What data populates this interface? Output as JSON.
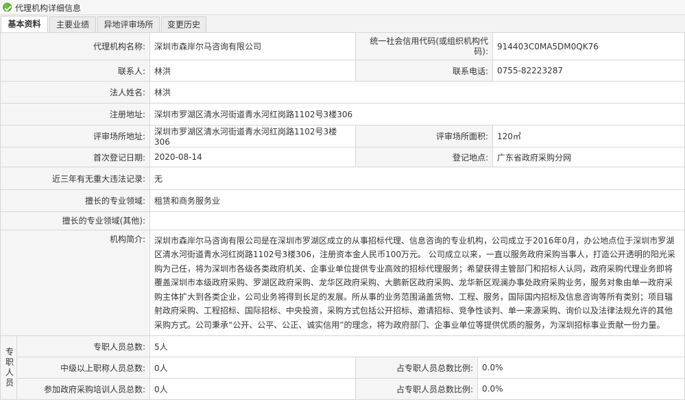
{
  "window": {
    "title": "代理机构详细信息",
    "icon": "info-check-icon"
  },
  "tabs": [
    {
      "label": "基本资料",
      "active": true
    },
    {
      "label": "主要业绩",
      "active": false
    },
    {
      "label": "异地评审场所",
      "active": false
    },
    {
      "label": "变更历史",
      "active": false
    }
  ],
  "info": {
    "agency_name": {
      "label": "代理机构名称:",
      "value": "深圳市森岸尔马咨询有限公司"
    },
    "credit_code": {
      "label": "统一社会信用代码(或组织机构代码):",
      "value": "914403C0MA5DM0QK76"
    },
    "contact": {
      "label": "联系人:",
      "value": "林洪"
    },
    "phone": {
      "label": "联系电话:",
      "value": "0755-82223287"
    },
    "legal_rep": {
      "label": "法人姓名:",
      "value": "林洪"
    },
    "reg_address": {
      "label": "注册地址:",
      "value": "深圳市罗湖区清水河街道青水河红岗路1102号3楼306"
    },
    "review_address": {
      "label": "评审场所地址:",
      "value": "深圳市罗湖区清水河街道青水河红岗路1102号3楼306"
    },
    "review_area": {
      "label": "评审场所面积:",
      "value": "120㎡"
    },
    "first_reg_date": {
      "label": "首次登记日期:",
      "value": "2020-08-14"
    },
    "reg_place": {
      "label": "登记地点:",
      "value": "广东省政府采购分网"
    },
    "violations": {
      "label": "近三年有无重大违法记录:",
      "value": "无"
    },
    "specialty": {
      "label": "擅长的专业领域:",
      "value": "租赁和商务服务业"
    },
    "specialty_other": {
      "label": "擅长的专业领域(其他):",
      "value": ""
    },
    "intro": {
      "label": "机构简介:",
      "value": "深圳市森岸尔马咨询有限公司是在深圳市罗湖区成立的从事招标代理、信息咨询的专业机构，公司成立于2016年0月，办公地点位于深圳市罗湖区清水河街道青水河红岗路1102号3楼306，注册资本金人民币100万元。 公司成立以来，一直以服务政府采购当事人，打造公开透明的阳光采购为己任，将为深圳市各级各类政府机关、企事业单位提供专业高效的招标代理服务；希望获得主管部门和招标人认同，政府采购代理业务即将覆盖深圳市本级政府采购、罗湖区政府采购、龙华区政府采购、大鹏新区政府采购、龙华新区观澜办事处政府采购业务，服务对象由单一政府采购主体扩大到各类企业，公司业务将得到长足的发展。所从事的业务范围涵盖货物、工程、服务，国际国内招标及信息咨询等所有类别；项目辐射政府采购、工程招标、国际招标、中央投资，采购方式包括公开招标、邀请招标、竞争性谈判、单一来源采购、询价以及法律法规允许的其他采购方式。公司秉承“公开、公平、公正、诚实信用”的理念，将为政府部门、企事业单位等提供优质的服务，为深圳招标事业贡献一份力量。"
    }
  },
  "staff": {
    "section_label": "专职人员",
    "total": {
      "label": "专职人员总数:",
      "value": "5人"
    },
    "senior": {
      "label": "中级以上职称人员总数:",
      "value": "0人"
    },
    "senior_ratio": {
      "label": "占专职人员总数比例:",
      "value": "0.0%"
    },
    "trained": {
      "label": "参加政府采购培训人员总数:",
      "value": "0人"
    },
    "trained_ratio": {
      "label": "占专职人员总数比例:",
      "value": "0.0%"
    }
  }
}
